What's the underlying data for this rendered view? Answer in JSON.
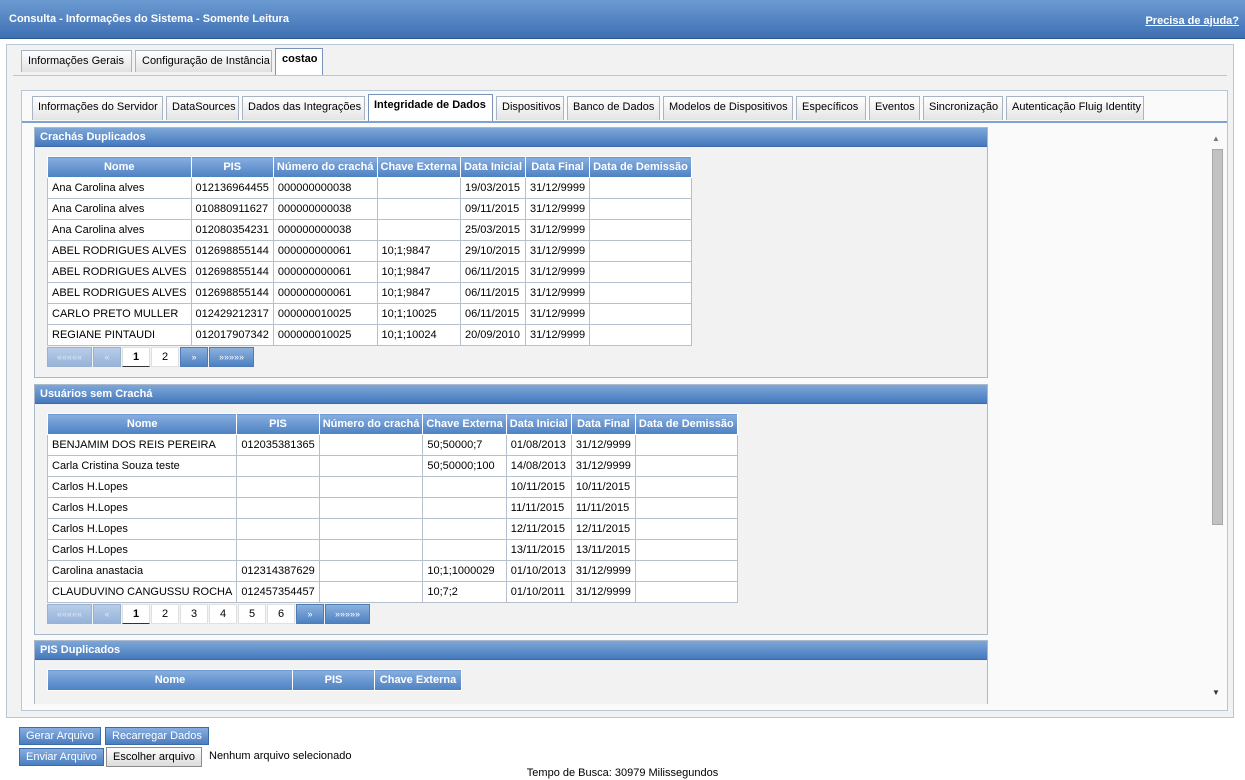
{
  "window": {
    "title": "Consulta - Informações do Sistema - Somente Leitura",
    "help_link": "Precisa de ajuda?"
  },
  "tabs_level1": [
    {
      "label": "Informações Gerais",
      "active": false
    },
    {
      "label": "Configuração de Instância",
      "active": false
    },
    {
      "label": "costao",
      "active": true
    }
  ],
  "tabs_level2": [
    {
      "label": "Informações do Servidor",
      "active": false
    },
    {
      "label": "DataSources",
      "active": false
    },
    {
      "label": "Dados das Integrações",
      "active": false
    },
    {
      "label": "Integridade de Dados",
      "active": true
    },
    {
      "label": "Dispositivos",
      "active": false
    },
    {
      "label": "Banco de Dados",
      "active": false
    },
    {
      "label": "Modelos de Dispositivos",
      "active": false
    },
    {
      "label": "Específicos",
      "active": false
    },
    {
      "label": "Eventos",
      "active": false
    },
    {
      "label": "Sincronização",
      "active": false
    },
    {
      "label": "Autenticação Fluig Identity",
      "active": false
    }
  ],
  "sections": {
    "crachas": {
      "title": "Crachás Duplicados",
      "columns": [
        "Nome",
        "PIS",
        "Número do crachá",
        "Chave Externa",
        "Data Inicial",
        "Data Final",
        "Data de Demissão"
      ],
      "rows": [
        [
          "Ana Carolina alves",
          "012136964455",
          "000000000038",
          "",
          "19/03/2015",
          "31/12/9999",
          ""
        ],
        [
          "Ana Carolina alves",
          "010880911627",
          "000000000038",
          "",
          "09/11/2015",
          "31/12/9999",
          ""
        ],
        [
          "Ana Carolina alves",
          "012080354231",
          "000000000038",
          "",
          "25/03/2015",
          "31/12/9999",
          ""
        ],
        [
          "ABEL RODRIGUES ALVES",
          "012698855144",
          "000000000061",
          "10;1;9847",
          "29/10/2015",
          "31/12/9999",
          ""
        ],
        [
          "ABEL RODRIGUES ALVES",
          "012698855144",
          "000000000061",
          "10;1;9847",
          "06/11/2015",
          "31/12/9999",
          ""
        ],
        [
          "ABEL RODRIGUES ALVES",
          "012698855144",
          "000000000061",
          "10;1;9847",
          "06/11/2015",
          "31/12/9999",
          ""
        ],
        [
          "CARLO PRETO MULLER",
          "012429212317",
          "000000010025",
          "10;1;10025",
          "06/11/2015",
          "31/12/9999",
          ""
        ],
        [
          "REGIANE PINTAUDI",
          "012017907342",
          "000000010025",
          "10;1;10024",
          "20/09/2010",
          "31/12/9999",
          ""
        ]
      ],
      "pager": {
        "first": "«««««",
        "prev": "«",
        "pages": [
          "1",
          "2"
        ],
        "current": "1",
        "next": "»",
        "last": "»»»»»"
      }
    },
    "usuarios": {
      "title": "Usuários sem Crachá",
      "columns": [
        "Nome",
        "PIS",
        "Número do crachá",
        "Chave Externa",
        "Data Inicial",
        "Data Final",
        "Data de Demissão"
      ],
      "rows": [
        [
          "BENJAMIM DOS REIS PEREIRA",
          "012035381365",
          "",
          "50;50000;7",
          "01/08/2013",
          "31/12/9999",
          ""
        ],
        [
          "Carla Cristina Souza teste",
          "",
          "",
          "50;50000;100",
          "14/08/2013",
          "31/12/9999",
          ""
        ],
        [
          "Carlos H.Lopes",
          "",
          "",
          "",
          "10/11/2015",
          "10/11/2015",
          ""
        ],
        [
          "Carlos H.Lopes",
          "",
          "",
          "",
          "11/11/2015",
          "11/11/2015",
          ""
        ],
        [
          "Carlos H.Lopes",
          "",
          "",
          "",
          "12/11/2015",
          "12/11/2015",
          ""
        ],
        [
          "Carlos H.Lopes",
          "",
          "",
          "",
          "13/11/2015",
          "13/11/2015",
          ""
        ],
        [
          "Carolina anastacia",
          "012314387629",
          "",
          "10;1;1000029",
          "01/10/2013",
          "31/12/9999",
          ""
        ],
        [
          "CLAUDUVINO CANGUSSU ROCHA",
          "012457354457",
          "",
          "10;7;2",
          "01/10/2011",
          "31/12/9999",
          ""
        ]
      ],
      "pager": {
        "first": "«««««",
        "prev": "«",
        "pages": [
          "1",
          "2",
          "3",
          "4",
          "5",
          "6"
        ],
        "current": "1",
        "next": "»",
        "last": "»»»»»"
      }
    },
    "pis": {
      "title": "PIS Duplicados",
      "columns": [
        "Nome",
        "PIS",
        "Chave Externa"
      ]
    }
  },
  "buttons": {
    "gerar": "Gerar Arquivo",
    "recarregar": "Recarregar Dados",
    "enviar": "Enviar Arquivo",
    "escolher": "Escolher arquivo",
    "no_file": "Nenhum arquivo selecionado"
  },
  "footer": {
    "search_time": "Tempo de Busca: 30979 Milissegundos"
  }
}
